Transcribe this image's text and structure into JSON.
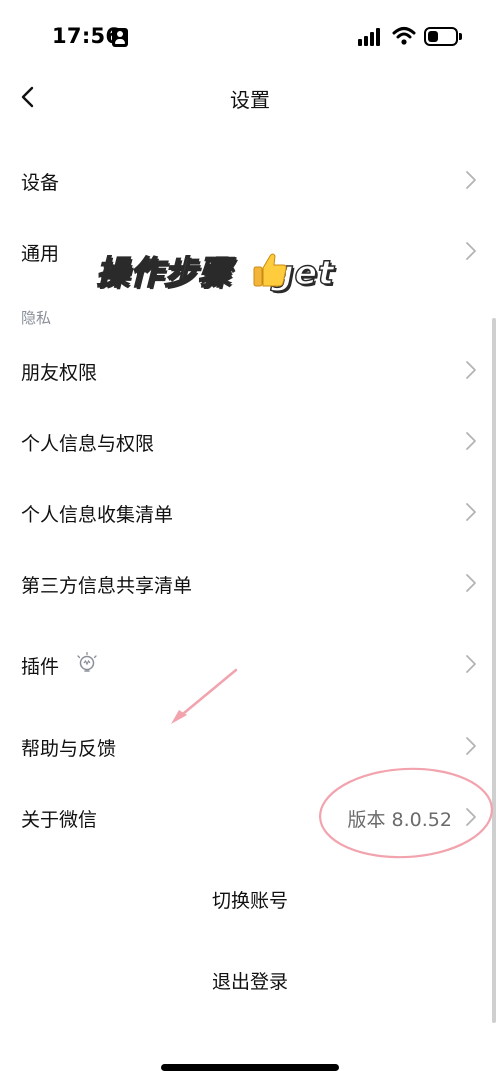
{
  "status_bar": {
    "time": "17:56"
  },
  "nav": {
    "title": "设置"
  },
  "rows": {
    "device": "设备",
    "general": "通用",
    "friend_permissions": "朋友权限",
    "personal_info_permissions": "个人信息与权限",
    "personal_info_list": "个人信息收集清单",
    "third_party_list": "第三方信息共享清单",
    "plugins": "插件",
    "help_feedback": "帮助与反馈",
    "about": "关于微信",
    "about_version": "版本 8.0.52"
  },
  "sections": {
    "privacy": "隐私"
  },
  "actions": {
    "switch_account": "切换账号",
    "logout": "退出登录"
  },
  "overlay": {
    "sticker_text": "操作步骤",
    "sticker_suffix": "get"
  },
  "colors": {
    "annotation": "#f2a3ad",
    "chevron": "#b4b4b4",
    "secondary_text": "#6b6b6b"
  },
  "icons": [
    "id-card-icon",
    "cellular-signal-icon",
    "wifi-icon",
    "battery-icon",
    "back-arrow-icon",
    "chevron-right-icon",
    "plugin-bulb-icon",
    "thumbs-up-icon"
  ]
}
